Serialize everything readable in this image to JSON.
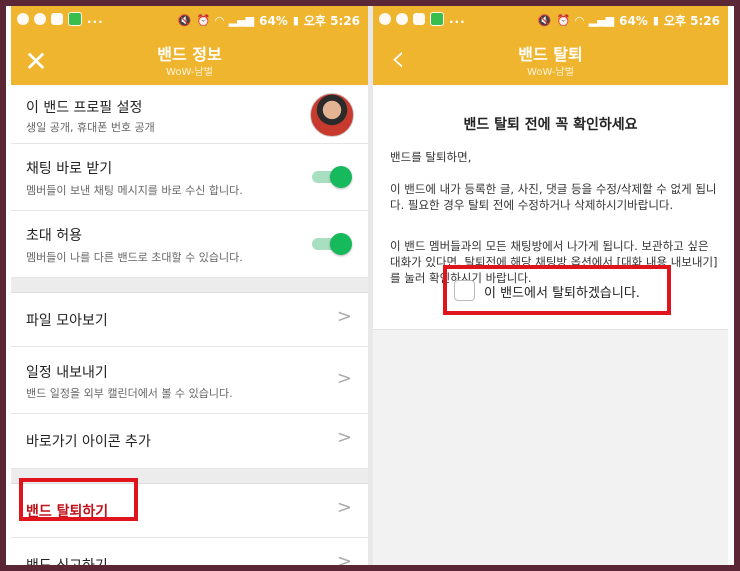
{
  "status_bar": {
    "time": "오후 5:26",
    "battery": "64%",
    "dots": "..."
  },
  "left_screen": {
    "header": {
      "title": "밴드 정보",
      "subtitle": "WoW-남벌",
      "close_icon": "✕"
    },
    "items": [
      {
        "title": "이 밴드 프로필 설정",
        "desc": "생일 공개, 휴대폰 번호 공개"
      },
      {
        "title": "채팅 바로 받기",
        "desc": "멤버들이 보낸 채팅 메시지를 바로 수신 합니다.",
        "toggle_on": true
      },
      {
        "title": "초대 허용",
        "desc": "멤버들이 나를 다른 밴드로 초대할 수 있습니다.",
        "toggle_on": true
      },
      {
        "title": "파일 모아보기"
      },
      {
        "title": "일정 내보내기",
        "desc": "밴드 일정을 외부 캘린더에서 볼 수 있습니다."
      },
      {
        "title": "바로가기 아이콘 추가"
      },
      {
        "title": "밴드 탈퇴하기"
      },
      {
        "title": "밴드 신고하기"
      }
    ],
    "highlight_color": "#e0141c",
    "danger_text_color": "#c0121a"
  },
  "right_screen": {
    "header": {
      "title": "밴드 탈퇴",
      "subtitle": "WoW-남벌",
      "back_icon": "‹"
    },
    "notice_title": "밴드 탈퇴 전에 꼭 확인하세요",
    "paragraphs": [
      "밴드를 탈퇴하면,",
      "이 밴드에 내가 등록한 글, 사진, 댓글 등을 수정/삭제할 수 없게 됩니다. 필요한 경우 탈퇴 전에 수정하거나 삭제하시기바랍니다.",
      "이 밴드 멤버들과의 모든 채팅방에서 나가게 됩니다. 보관하고 싶은 대화가 있다면, 탈퇴전에 해당 채팅방 옵션에서 [대화 내용 내보내기] 를 눌러 확인하시기 바랍니다."
    ],
    "confirm_label": "이 밴드에서 탈퇴하겠습니다.",
    "confirm_checked": false
  },
  "colors": {
    "header_yellow": "#efb52f",
    "toggle_green": "#16b95c",
    "frame_background": "#5b2635"
  }
}
